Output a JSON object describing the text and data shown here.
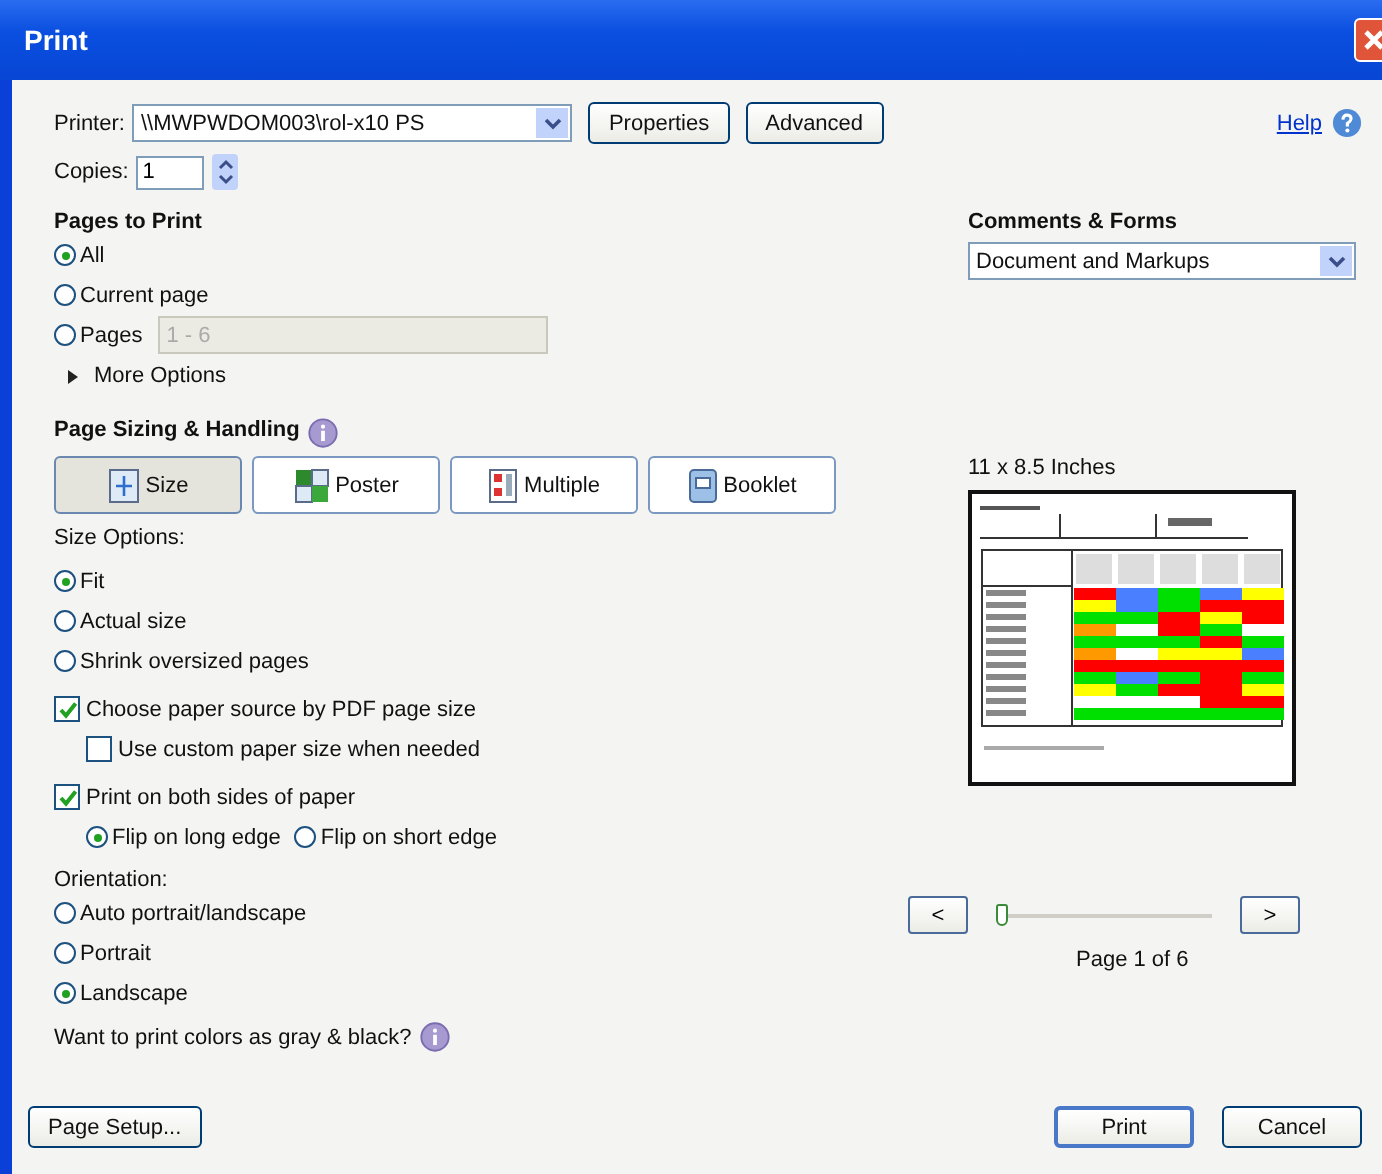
{
  "window": {
    "title": "Print"
  },
  "printer": {
    "label": "Printer:",
    "value": "\\\\MWPWDOM003\\rol-x10 PS",
    "buttons": [
      "Properties",
      "Advanced"
    ]
  },
  "help": {
    "label": "Help"
  },
  "copies": {
    "label": "Copies:",
    "value": "1"
  },
  "pages_to_print": {
    "title": "Pages to Print",
    "options": [
      {
        "label": "All",
        "selected": true
      },
      {
        "label": "Current page",
        "selected": false
      },
      {
        "label": "Pages",
        "selected": false
      }
    ],
    "pages_field": {
      "value": "1 - 6",
      "disabled": true
    },
    "more_options": {
      "label": "More Options",
      "expanded": false
    }
  },
  "page_sizing": {
    "title": "Page Sizing & Handling",
    "modes": [
      {
        "label": "Size",
        "selected": true
      },
      {
        "label": "Poster",
        "selected": false
      },
      {
        "label": "Multiple",
        "selected": false
      },
      {
        "label": "Booklet",
        "selected": false
      }
    ],
    "size_options_label": "Size Options:",
    "size_options": [
      {
        "label": "Fit",
        "selected": true
      },
      {
        "label": "Actual size",
        "selected": false
      },
      {
        "label": "Shrink oversized pages",
        "selected": false
      }
    ],
    "checkboxes": [
      {
        "label": "Choose paper source by PDF page size",
        "checked": true,
        "children": [
          {
            "label": "Use custom paper size when needed",
            "checked": false
          }
        ]
      },
      {
        "label": "Print on both sides of paper",
        "checked": true,
        "flip_options": [
          {
            "label": "Flip on long edge",
            "selected": true
          },
          {
            "label": "Flip on short edge",
            "selected": false
          }
        ]
      }
    ],
    "orientation_label": "Orientation:",
    "orientation": [
      {
        "label": "Auto portrait/landscape",
        "selected": false
      },
      {
        "label": "Portrait",
        "selected": false
      },
      {
        "label": "Landscape",
        "selected": true
      }
    ],
    "gray_question": "Want to print colors as gray & black?"
  },
  "comments_forms": {
    "title": "Comments & Forms",
    "value": "Document and Markups"
  },
  "preview": {
    "size": "11 x 8.5 Inches",
    "prev": "<",
    "next": ">",
    "slider": {
      "level": 0
    },
    "page_label": "Page 1 of 6"
  },
  "footer": {
    "page_setup": "Page Setup...",
    "print": "Print",
    "cancel": "Cancel"
  }
}
